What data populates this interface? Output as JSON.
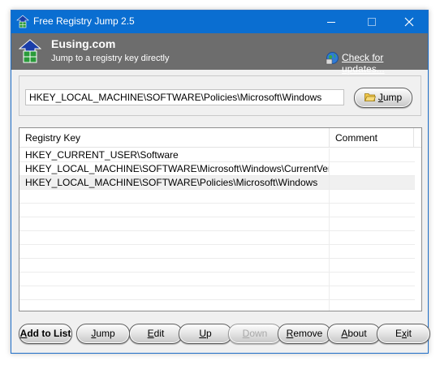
{
  "window": {
    "title": "Free Registry Jump 2.5"
  },
  "header": {
    "brand": "Eusing.com",
    "tagline": "Jump to a registry key directly",
    "update_link": "Check for updates..."
  },
  "jump_bar": {
    "key_value": "HKEY_LOCAL_MACHINE\\SOFTWARE\\Policies\\Microsoft\\Windows",
    "jump_label_prefix": "",
    "jump_label_u": "J",
    "jump_label_rest": "ump"
  },
  "list": {
    "columns": [
      "Registry Key",
      "Comment"
    ],
    "rows": [
      {
        "key": "HKEY_CURRENT_USER\\Software",
        "comment": ""
      },
      {
        "key": "HKEY_LOCAL_MACHINE\\SOFTWARE\\Microsoft\\Windows\\CurrentVersion",
        "comment": ""
      },
      {
        "key": "HKEY_LOCAL_MACHINE\\SOFTWARE\\Policies\\Microsoft\\Windows",
        "comment": ""
      }
    ],
    "selected_row": 2
  },
  "buttons": {
    "add": {
      "u": "A",
      "rest": "dd to List"
    },
    "jump": {
      "u": "J",
      "rest": "ump"
    },
    "edit": {
      "u": "E",
      "rest": "dit"
    },
    "up": {
      "u": "U",
      "rest": "p"
    },
    "down": {
      "u": "D",
      "rest": "own"
    },
    "remove": {
      "u": "R",
      "rest": "emove"
    },
    "about": {
      "u": "A",
      "rest": "bout"
    },
    "exit": {
      "pre": "E",
      "u": "x",
      "rest": "it"
    }
  },
  "colors": {
    "titlebar": "#0a6ed1",
    "header": "#6d6d6d"
  },
  "icons": [
    "app-icon",
    "minimize-icon",
    "maximize-icon",
    "close-icon",
    "globe-update-icon",
    "folder-icon"
  ]
}
